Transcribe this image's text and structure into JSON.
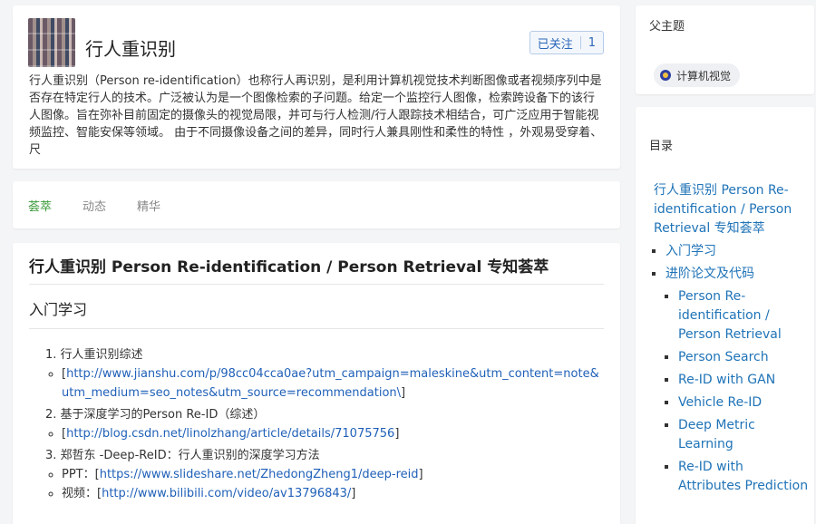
{
  "topic": {
    "title": "行人重识别",
    "follow_label": "已关注",
    "follow_count": "1",
    "description": "行人重识别（Person re-identification）也称行人再识别，是利用计算机视觉技术判断图像或者视频序列中是否存在特定行人的技术。广泛被认为是一个图像检索的子问题。给定一个监控行人图像，检索跨设备下的该行人图像。旨在弥补目前固定的摄像头的视觉局限，并可与行人检测/行人跟踪技术相结合，可广泛应用于智能视频监控、智能安保等领域。 由于不同摄像设备之间的差异，同时行人兼具刚性和柔性的特性 ，外观易受穿着、尺"
  },
  "tabs": [
    {
      "label": "荟萃"
    },
    {
      "label": "动态"
    },
    {
      "label": "精华"
    }
  ],
  "content": {
    "heading": "行人重识别 Person Re-identification / Person Retrieval 专知荟萃",
    "section": "入门学习",
    "items": [
      {
        "text": "1. 行人重识别综述",
        "sub": [
          {
            "prefix": "[",
            "link": "http://www.jianshu.com/p/98cc04cca0ae?utm_campaign=maleskine&utm_content=note&utm_medium=seo_notes&utm_source=recommendation\\",
            "suffix": "]"
          }
        ]
      },
      {
        "text": "2. 基于深度学习的Person Re-ID（综述）",
        "sub": [
          {
            "prefix": "[",
            "link": "http://blog.csdn.net/linolzhang/article/details/71075756",
            "suffix": "]"
          }
        ]
      },
      {
        "text": "3. 郑哲东 -Deep-ReID：行人重识别的深度学习方法",
        "sub": [
          {
            "prefix": "PPT：[",
            "link": "https://www.slideshare.net/ZhedongZheng1/deep-reid",
            "suffix": "]"
          },
          {
            "prefix": "视频：[",
            "link": "http://www.bilibili.com/video/av13796843/",
            "suffix": "]"
          }
        ]
      }
    ]
  },
  "sidebar": {
    "parent_title": "父主题",
    "parent_chip": "计算机视觉",
    "toc_title": "目录",
    "toc_root": "行人重识别 Person Re-identification / Person Retrieval 专知荟萃",
    "toc_l1": [
      "入门学习",
      "进阶论文及代码"
    ],
    "toc_l2": [
      "Person Re-identification / Person Retrieval",
      "Person Search",
      "Re-ID with GAN",
      "Vehicle Re-ID",
      "Deep Metric Learning",
      "Re-ID with Attributes Prediction"
    ]
  }
}
